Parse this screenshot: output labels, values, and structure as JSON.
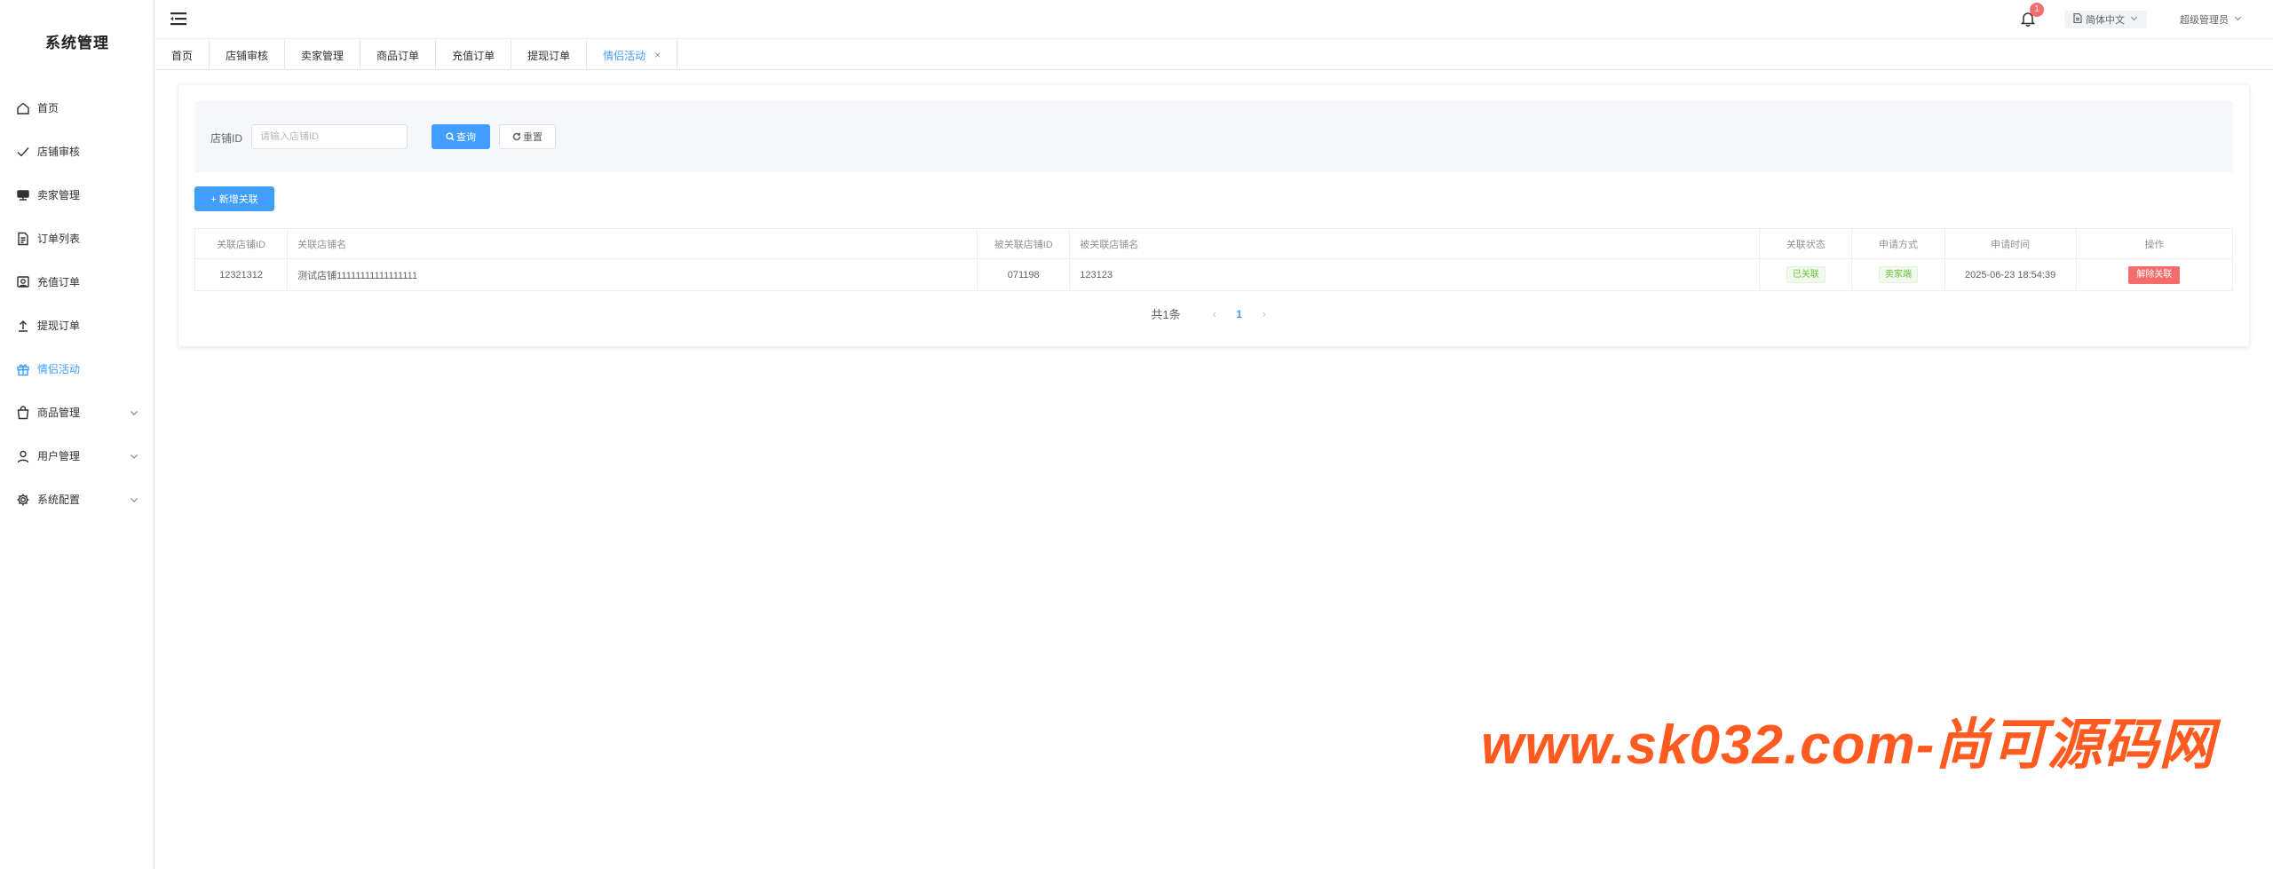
{
  "sidebar": {
    "brand": "系统管理",
    "items": [
      {
        "label": "首页",
        "icon": "home-icon"
      },
      {
        "label": "店铺审核",
        "icon": "check-icon"
      },
      {
        "label": "卖家管理",
        "icon": "seller-icon"
      },
      {
        "label": "订单列表",
        "icon": "document-icon"
      },
      {
        "label": "充值订单",
        "icon": "recharge-icon"
      },
      {
        "label": "提现订单",
        "icon": "upload-icon"
      },
      {
        "label": "情侣活动",
        "icon": "gift-icon",
        "active": true
      },
      {
        "label": "商品管理",
        "icon": "bag-icon",
        "expandable": true
      },
      {
        "label": "用户管理",
        "icon": "user-icon",
        "expandable": true
      },
      {
        "label": "系统配置",
        "icon": "settings-icon",
        "expandable": true
      }
    ]
  },
  "header": {
    "notification_count": "1",
    "language": "简体中文",
    "user": "超级管理员"
  },
  "tabs": [
    {
      "label": "首页"
    },
    {
      "label": "店铺审核"
    },
    {
      "label": "卖家管理"
    },
    {
      "label": "商品订单"
    },
    {
      "label": "充值订单"
    },
    {
      "label": "提现订单"
    },
    {
      "label": "情侣活动",
      "active": true,
      "close": "×"
    }
  ],
  "filter": {
    "shop_id_label": "店铺ID",
    "shop_id_placeholder": "请输入店铺ID",
    "shop_id_value": "",
    "search_label": "查询",
    "reset_label": "重置"
  },
  "add_button": "+ 新增关联",
  "table": {
    "columns": [
      "关联店铺ID",
      "关联店铺名",
      "被关联店铺ID",
      "被关联店铺名",
      "关联状态",
      "申请方式",
      "申请时间",
      "操作"
    ],
    "rows": [
      {
        "shop_id": "12321312",
        "shop_name": "测试店铺11111111111111111",
        "linked_id": "071198",
        "linked_name": "123123",
        "status": "已关联",
        "method": "卖家端",
        "time": "2025-06-23 18:54:39",
        "action": "解除关联"
      }
    ]
  },
  "pagination": {
    "total": "共1条",
    "prev": "‹",
    "current": "1",
    "next": "›"
  },
  "watermark": "www.sk032.com-尚可源码网",
  "colors": {
    "primary": "#409eff",
    "danger": "#f56c6c",
    "success": "#67c23a",
    "watermark": "#ff5a1f"
  }
}
